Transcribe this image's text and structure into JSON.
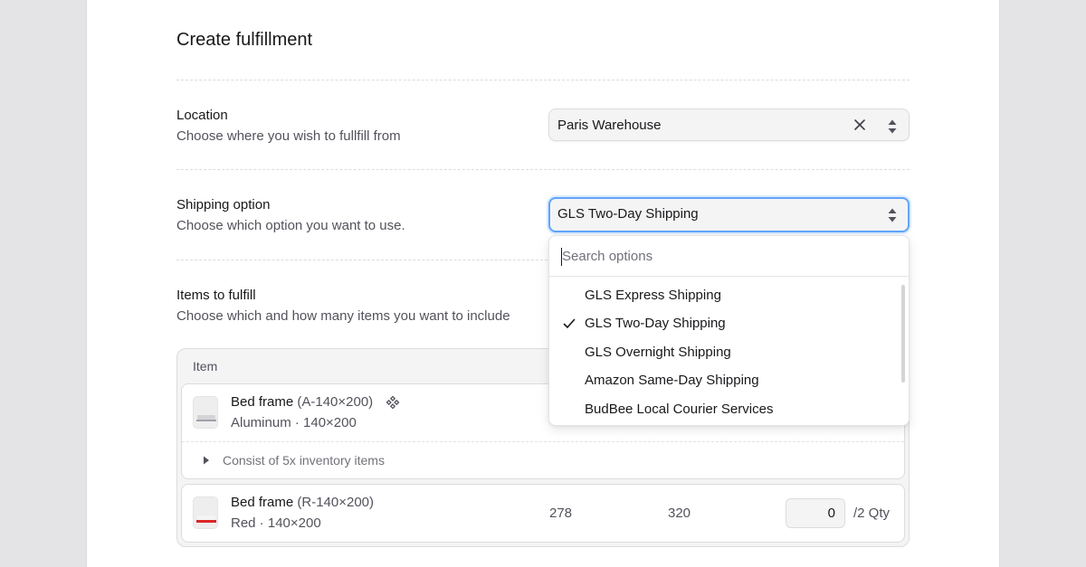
{
  "page": {
    "title": "Create fulfillment"
  },
  "location": {
    "title": "Location",
    "subtitle": "Choose where you wish to fullfill from",
    "value": "Paris Warehouse"
  },
  "shipping": {
    "title": "Shipping option",
    "subtitle": "Choose which option you want to use.",
    "value": "GLS Two-Day Shipping",
    "search_placeholder": "Search options",
    "options": [
      {
        "label": "GLS Express Shipping",
        "selected": false
      },
      {
        "label": "GLS Two-Day Shipping",
        "selected": true
      },
      {
        "label": "GLS Overnight Shipping",
        "selected": false
      },
      {
        "label": "Amazon Same-Day Shipping",
        "selected": false
      },
      {
        "label": "BudBee Local Courier Services",
        "selected": false
      }
    ]
  },
  "items_section": {
    "title": "Items to fulfill",
    "subtitle": "Choose which and how many items you want to include",
    "column_item": "Item",
    "items": [
      {
        "name": "Bed frame",
        "sku": "(A-140×200)",
        "variant": "Aluminum · 140×200",
        "has_components": true,
        "components_text": "Consist of 5x inventory items"
      },
      {
        "name": "Bed frame",
        "sku": "(R-140×200)",
        "variant": "Red · 140×200",
        "stock_a": "278",
        "stock_b": "320",
        "qty_value": "0",
        "qty_label": "/2 Qty"
      }
    ]
  },
  "icons": {
    "clear": "close-icon",
    "select": "chevron-up-down-icon",
    "check": "check-icon",
    "components": "components-icon",
    "expand": "triangle-right-icon"
  },
  "colors": {
    "focus_ring": "#60a5fa",
    "page_bg": "#e4e4e7"
  }
}
